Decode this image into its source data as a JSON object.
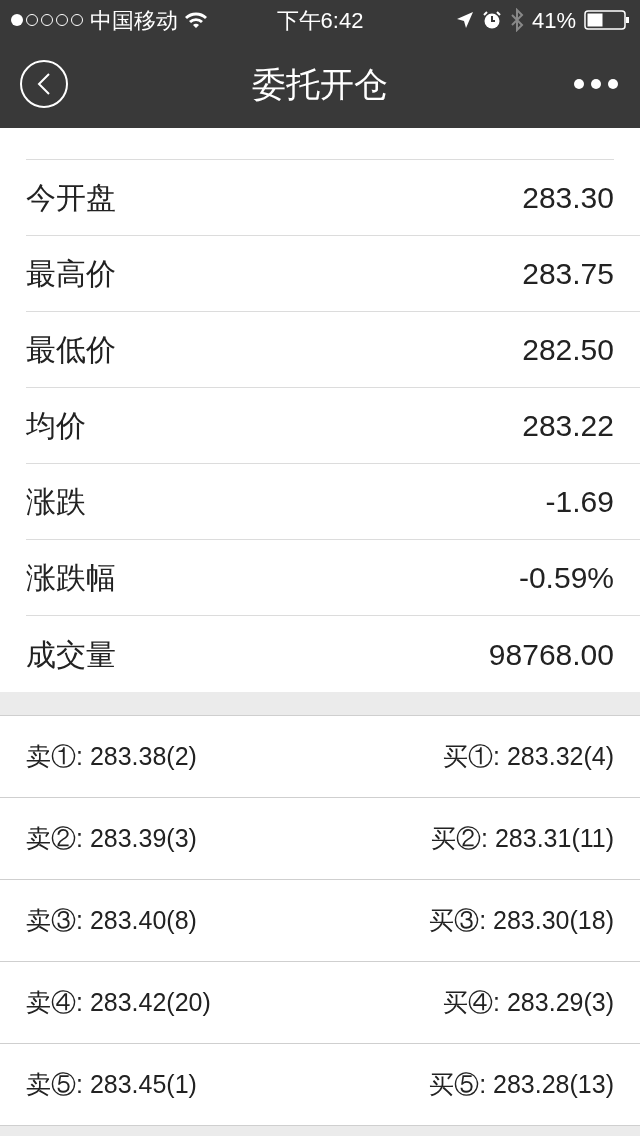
{
  "status_bar": {
    "carrier": "中国移动",
    "time": "下午6:42",
    "battery": "41%"
  },
  "header": {
    "title": "委托开仓"
  },
  "quote_rows": [
    {
      "label": "今开盘",
      "value": "283.30"
    },
    {
      "label": "最高价",
      "value": "283.75"
    },
    {
      "label": "最低价",
      "value": "282.50"
    },
    {
      "label": "均价",
      "value": "283.22"
    },
    {
      "label": "涨跌",
      "value": "-1.69"
    },
    {
      "label": "涨跌幅",
      "value": "-0.59%"
    },
    {
      "label": "成交量",
      "value": "98768.00"
    }
  ],
  "order_book": [
    {
      "ask": "卖①: 283.38(2)",
      "bid": "买①: 283.32(4)"
    },
    {
      "ask": "卖②: 283.39(3)",
      "bid": "买②: 283.31(11)"
    },
    {
      "ask": "卖③: 283.40(8)",
      "bid": "买③: 283.30(18)"
    },
    {
      "ask": "卖④: 283.42(20)",
      "bid": "买④: 283.29(3)"
    },
    {
      "ask": "卖⑤: 283.45(1)",
      "bid": "买⑤: 283.28(13)"
    }
  ]
}
